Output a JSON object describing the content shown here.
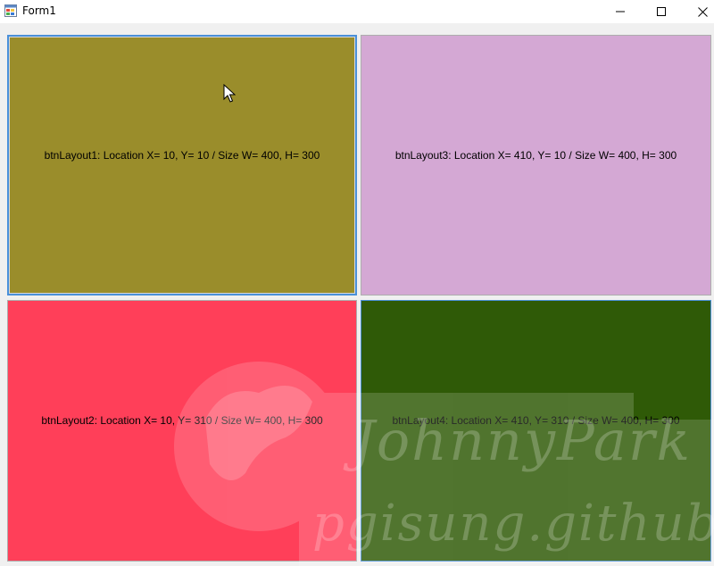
{
  "window": {
    "title": "Form1",
    "icons": {
      "app": "winforms-app-icon",
      "minimize": "minimize-icon",
      "maximize": "maximize-icon",
      "close": "close-icon"
    }
  },
  "buttons": [
    {
      "label": "btnLayout1: Location X= 10, Y= 10 / Size W= 400, H= 300",
      "color": "#9a8d2b"
    },
    {
      "label": "btnLayout2: Location X= 10, Y= 310 / Size W= 400, H= 300",
      "color": "#ff3f59"
    },
    {
      "label": "btnLayout3: Location X= 410, Y= 10 / Size W= 400, H= 300",
      "color": "#d4a8d4"
    },
    {
      "label": "btnLayout4: Location X= 410, Y= 310 / Size W= 400, H= 300",
      "color": "#2f5a07"
    }
  ],
  "watermark": {
    "line1": "JohnnyPark",
    "line2": "pgisung.github.io"
  },
  "colors": {
    "focus_border": "#4a90d9",
    "titlebar_bg": "#ffffff",
    "form_bg": "#f0f0f0"
  }
}
